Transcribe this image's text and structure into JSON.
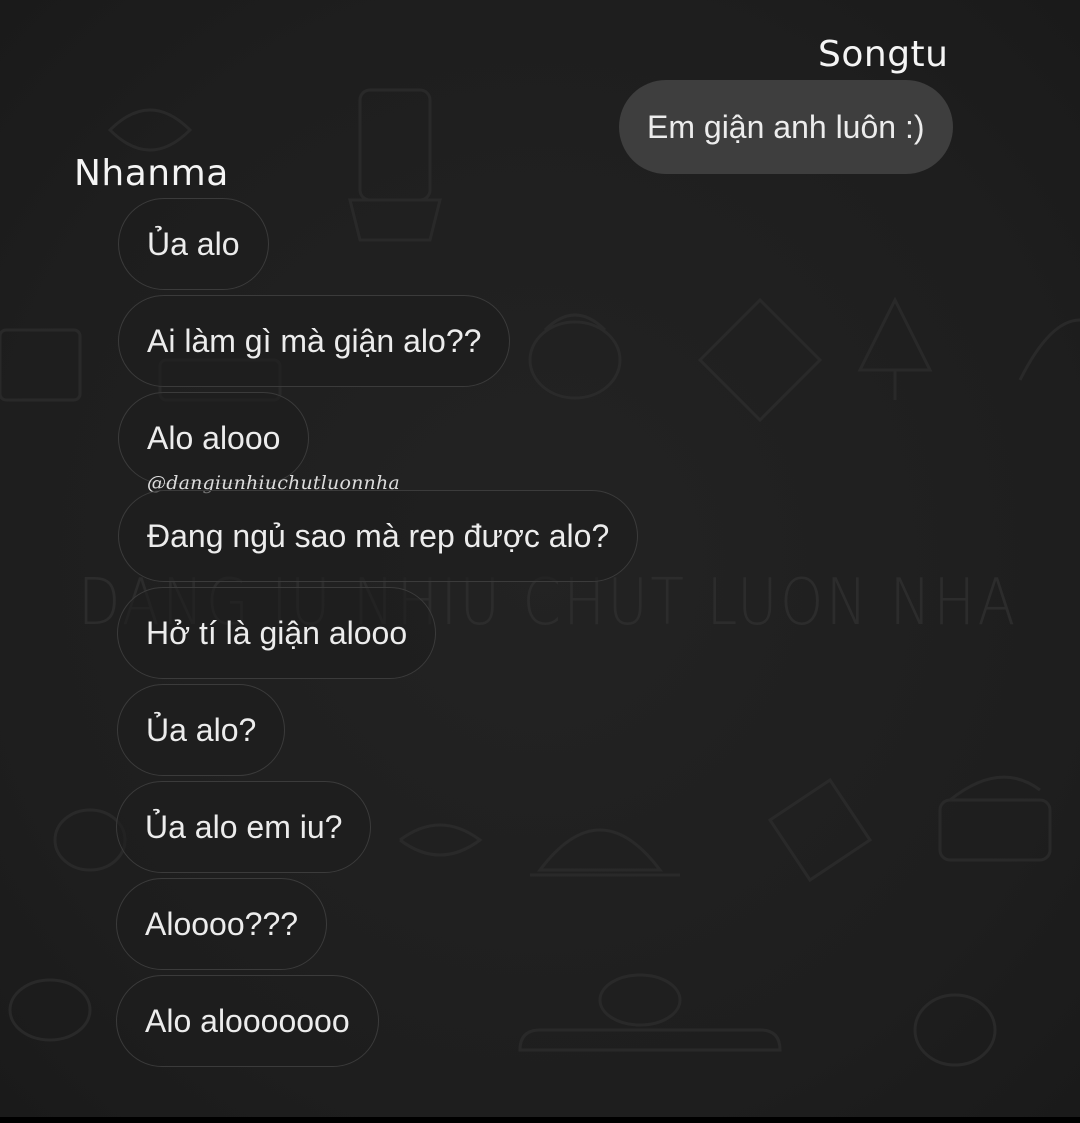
{
  "senders": {
    "outgoing": "Songtu",
    "incoming": "Nhanma"
  },
  "outgoing_messages": [
    "Em giận anh luôn :)"
  ],
  "incoming_messages": [
    "Ủa alo",
    "Ai làm gì mà giận alo??",
    "Alo alooo",
    "Đang ngủ sao mà rep được alo?",
    "Hở tí là giận alooo",
    "Ủa alo?",
    "Ủa alo em iu?",
    "Aloooo???",
    "Alo alooooooo"
  ],
  "watermark": {
    "credit": "@dangiunhiuchutluonnha",
    "big": "DANG IU NHIU CHUT LUON NHA"
  },
  "colors": {
    "background": "#1f1f1f",
    "outgoing_bubble": "#3e3e3e",
    "incoming_border": "#3b3b3b",
    "text": "#ececec"
  }
}
